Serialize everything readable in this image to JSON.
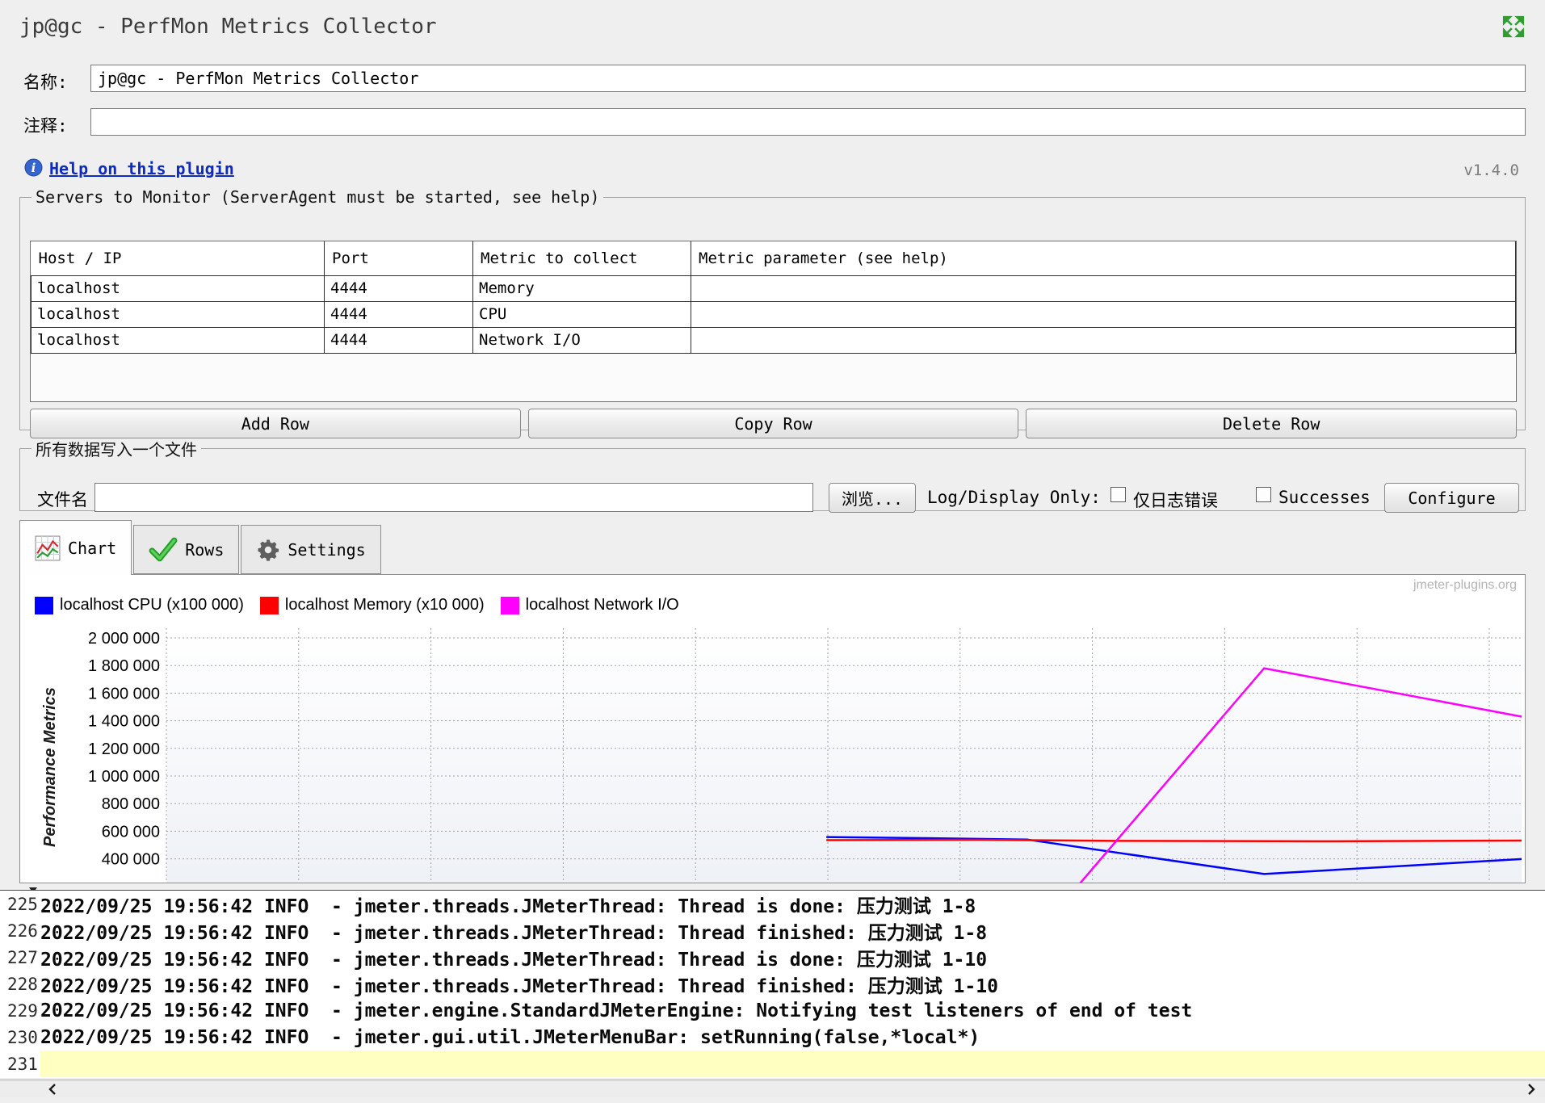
{
  "window": {
    "title": "jp@gc - PerfMon Metrics Collector",
    "version": "v1.4.0"
  },
  "header": {
    "name_label": "名称:",
    "name_value": "jp@gc - PerfMon Metrics Collector",
    "comments_label": "注释:",
    "comments_value": "",
    "help_link": "Help on this plugin"
  },
  "servers_group": {
    "title": "Servers to Monitor (ServerAgent must be started, see help)",
    "columns": [
      "Host / IP",
      "Port",
      "Metric to collect",
      "Metric parameter (see help)"
    ],
    "rows": [
      {
        "host": "localhost",
        "port": "4444",
        "metric": "Memory",
        "param": ""
      },
      {
        "host": "localhost",
        "port": "4444",
        "metric": "CPU",
        "param": ""
      },
      {
        "host": "localhost",
        "port": "4444",
        "metric": "Network I/O",
        "param": ""
      }
    ],
    "add_button": "Add Row",
    "copy_button": "Copy Row",
    "delete_button": "Delete Row"
  },
  "file_group": {
    "title": "所有数据写入一个文件",
    "filename_label": "文件名",
    "filename_value": "",
    "browse_button": "浏览...",
    "log_display_label": "Log/Display Only:",
    "errors_only_label": "仅日志错误",
    "errors_only_checked": false,
    "successes_label": "Successes",
    "successes_checked": false,
    "configure_button": "Configure"
  },
  "tabs": {
    "chart": "Chart",
    "rows": "Rows",
    "settings": "Settings",
    "active": "Chart"
  },
  "chart_data": {
    "type": "line",
    "title": "",
    "xlabel": "",
    "ylabel": "Performance Metrics",
    "watermark": "jmeter-plugins.org",
    "grid": true,
    "legend_position": "top-left",
    "y_axis": {
      "top_value": 2000000,
      "tick_step": 200000,
      "tick_labels": [
        "2 000 000",
        "1 800 000",
        "1 600 000",
        "1 400 000",
        "1 200 000",
        "1 000 000",
        "800 000",
        "600 000",
        "400 000"
      ]
    },
    "x_axis": {
      "visible_labels": false,
      "vertical_gridlines": 11
    },
    "series": [
      {
        "name": "localhost CPU (x100 000)",
        "color": "#0000ff",
        "points": [
          [
            0.487,
            558000
          ],
          [
            0.56,
            550000
          ],
          [
            0.635,
            540000
          ],
          [
            0.81,
            290000
          ],
          [
            1.0,
            398000
          ]
        ]
      },
      {
        "name": "localhost Memory (x10 000)",
        "color": "#ff0000",
        "points": [
          [
            0.487,
            535000
          ],
          [
            0.6,
            538000
          ],
          [
            0.7,
            530000
          ],
          [
            0.85,
            527000
          ],
          [
            1.0,
            532000
          ]
        ]
      },
      {
        "name": "localhost Network I/O",
        "color": "#ff00ff",
        "points": [
          [
            0.487,
            15000
          ],
          [
            0.66,
            60000
          ],
          [
            0.81,
            1780000
          ],
          [
            1.0,
            1430000
          ]
        ]
      }
    ]
  },
  "log": {
    "lines": [
      {
        "num": "225",
        "text": "2022/09/25 19:56:42 INFO  - jmeter.threads.JMeterThread: Thread is done: 压力测试 1-8",
        "highlight": false
      },
      {
        "num": "226",
        "text": "2022/09/25 19:56:42 INFO  - jmeter.threads.JMeterThread: Thread finished: 压力测试 1-8",
        "highlight": false
      },
      {
        "num": "227",
        "text": "2022/09/25 19:56:42 INFO  - jmeter.threads.JMeterThread: Thread is done: 压力测试 1-10",
        "highlight": false
      },
      {
        "num": "228",
        "text": "2022/09/25 19:56:42 INFO  - jmeter.threads.JMeterThread: Thread finished: 压力测试 1-10",
        "highlight": false
      },
      {
        "num": "229",
        "text": "2022/09/25 19:56:42 INFO  - jmeter.engine.StandardJMeterEngine: Notifying test listeners of end of test",
        "highlight": false
      },
      {
        "num": "230",
        "text": "2022/09/25 19:56:42 INFO  - jmeter.gui.util.JMeterMenuBar: setRunning(false,*local*)",
        "highlight": false
      },
      {
        "num": "231",
        "text": "",
        "highlight": true
      }
    ]
  }
}
